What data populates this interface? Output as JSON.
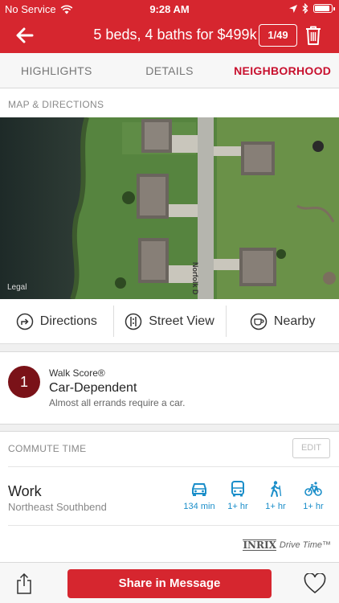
{
  "status_bar": {
    "carrier": "No Service",
    "time": "9:28 AM",
    "icons": [
      "wifi-icon",
      "location-arrow-icon",
      "bluetooth-icon",
      "battery-icon"
    ]
  },
  "header": {
    "title": "5 beds, 4 baths for $499k",
    "counter": "1/49",
    "icons": [
      "back-arrow-icon",
      "trash-icon"
    ]
  },
  "tabs": [
    {
      "label": "HIGHLIGHTS",
      "active": false
    },
    {
      "label": "DETAILS",
      "active": false
    },
    {
      "label": "NEIGHBORHOOD",
      "active": true
    }
  ],
  "map": {
    "section_label": "MAP & DIRECTIONS",
    "legal": "Legal",
    "road_label": "Norfolk D"
  },
  "actions": [
    {
      "label": "Directions",
      "icon": "directions-icon"
    },
    {
      "label": "Street View",
      "icon": "street-view-icon"
    },
    {
      "label": "Nearby",
      "icon": "coffee-cup-icon"
    }
  ],
  "walk_score": {
    "score": "1",
    "label": "Walk Score®",
    "title": "Car-Dependent",
    "description": "Almost all errands require a car."
  },
  "commute": {
    "section_label": "COMMUTE TIME",
    "edit_label": "EDIT",
    "destination": "Work",
    "location": "Northeast Southbend",
    "modes": [
      {
        "icon": "car-icon",
        "value": "134 min"
      },
      {
        "icon": "bus-icon",
        "value": "1+ hr"
      },
      {
        "icon": "hiker-icon",
        "value": "1+ hr"
      },
      {
        "icon": "bicycle-icon",
        "value": "1+ hr"
      }
    ],
    "provider_logo": "INRIX",
    "provider_text": "Drive Time™"
  },
  "bottom_bar": {
    "share_button": "Share in Message",
    "icons": [
      "share-icon",
      "heart-icon"
    ]
  },
  "colors": {
    "brand_red": "#d6262f",
    "walk_score_circle": "#7a1218",
    "commute_blue": "#1b8ec9",
    "active_tab": "#c8102e"
  }
}
